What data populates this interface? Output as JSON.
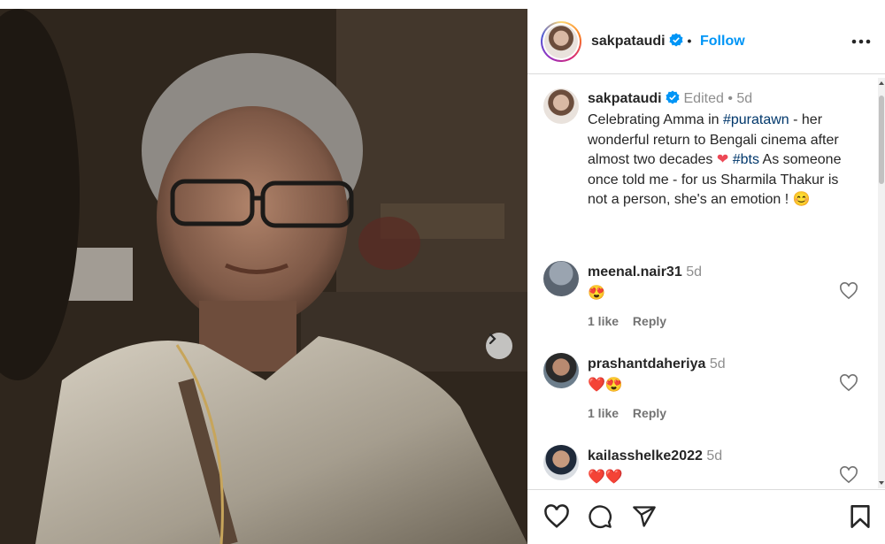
{
  "post": {
    "username": "sakpataudi",
    "follow_label": "Follow",
    "dot": "•"
  },
  "caption": {
    "username": "sakpataudi",
    "edited_label": "Edited",
    "dot": "•",
    "time": "5d",
    "text_part1": "Celebrating Amma in ",
    "hashtag1": "#puratawn",
    "text_part2": " - her wonderful return to Bengali cinema after almost two decades ",
    "hashtag2": "#bts",
    "text_part3": " As someone once told me - for us Sharmila Thakur is not a person, she's an emotion ! ",
    "emoji_heart": "❤",
    "emoji_smile": "😊"
  },
  "comments": [
    {
      "username": "meenal.nair31",
      "time": "5d",
      "body": "😍",
      "likes": "1 like",
      "reply": "Reply"
    },
    {
      "username": "prashantdaheriya",
      "time": "5d",
      "body": "❤️😍",
      "likes": "1 like",
      "reply": "Reply"
    },
    {
      "username": "kailasshelke2022",
      "time": "5d",
      "body": "❤️❤️"
    }
  ],
  "colors": {
    "link_blue": "#0095f6",
    "hashtag": "#00376b",
    "verified": "#0095f6",
    "heart_red": "#ed4956"
  },
  "icons": {
    "verified": "verified-badge-icon",
    "more": "more-options-icon",
    "next": "chevron-right-icon",
    "like": "heart-icon",
    "comment": "comment-icon",
    "share": "send-icon",
    "save": "bookmark-icon"
  }
}
